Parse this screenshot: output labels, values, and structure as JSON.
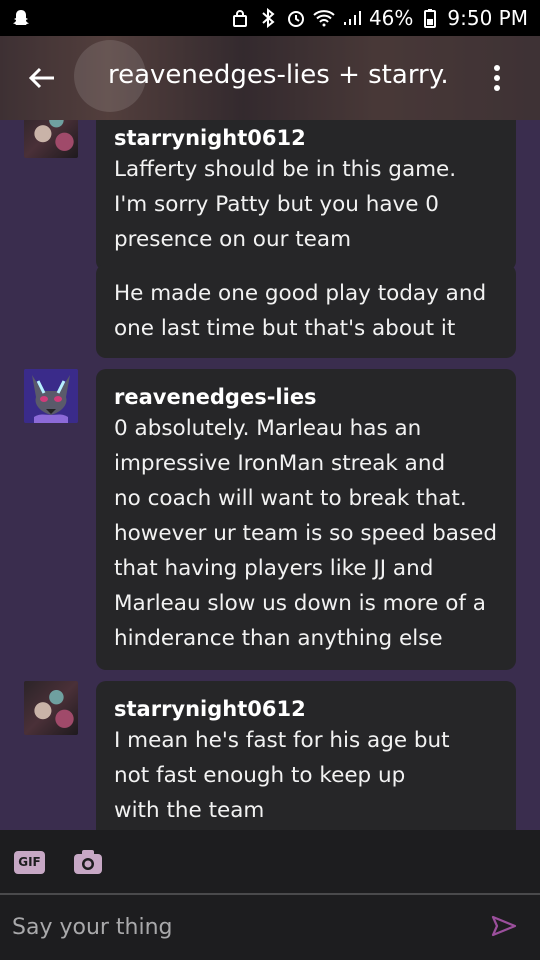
{
  "status_bar": {
    "battery_percent": "46%",
    "time": "9:50 PM"
  },
  "header": {
    "title": "reavenedges-lies + starry..."
  },
  "messages": [
    {
      "author": "starrynight0612",
      "avatar": "user-photo-avatar",
      "bubbles": [
        [
          "Lafferty should be in this game.",
          "I'm sorry Patty but you have 0",
          "presence on our team"
        ],
        [
          "He made one good play today and",
          "one last time but that's about it"
        ]
      ]
    },
    {
      "author": "reavenedges-lies",
      "avatar": "wolf-avatar",
      "bubbles": [
        [
          "0 absolutely. Marleau has an",
          "impressive IronMan streak and",
          "no coach will want to break that.",
          "however ur team is so speed based",
          "that having players like JJ and",
          "Marleau slow us down is more of a",
          "hinderance than anything else"
        ]
      ]
    },
    {
      "author": "starrynight0612",
      "avatar": "user-photo-avatar",
      "bubbles": [
        [
          "I mean he's fast for his age but",
          "not fast enough to keep up",
          "with the team"
        ]
      ]
    }
  ],
  "toolbar": {
    "gif_label": "GIF"
  },
  "composer": {
    "placeholder": "Say your thing"
  },
  "colors": {
    "background": "#3a2d4e",
    "bubble": "#262628",
    "accent": "#c7a8c5",
    "send": "#9b4f9c"
  }
}
